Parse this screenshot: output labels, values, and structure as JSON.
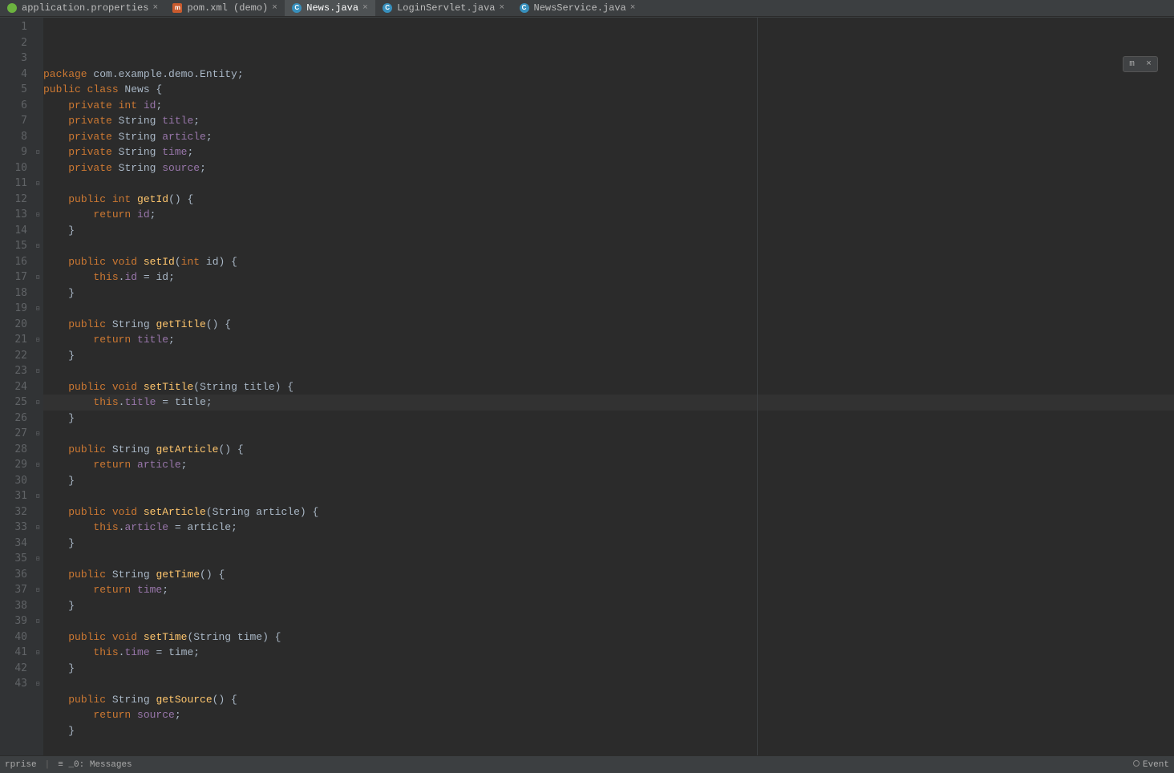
{
  "tabs": [
    {
      "icon": "spring",
      "label": "application.properties",
      "active": false
    },
    {
      "icon": "mvn",
      "label": "pom.xml (demo)",
      "active": false
    },
    {
      "icon": "java",
      "label": "News.java",
      "active": true
    },
    {
      "icon": "java",
      "label": "LoginServlet.java",
      "active": false
    },
    {
      "icon": "java",
      "label": "NewsService.java",
      "active": false
    }
  ],
  "overlay": {
    "badge": "m",
    "close": "×"
  },
  "code": [
    {
      "n": 1,
      "f": "",
      "h": [
        [
          "k",
          "package "
        ],
        [
          "t",
          "com.example.demo.Entity;"
        ]
      ]
    },
    {
      "n": 2,
      "f": "",
      "h": [
        [
          "k",
          "public class "
        ],
        [
          "t",
          "News {"
        ]
      ]
    },
    {
      "n": 3,
      "f": "",
      "h": [
        [
          "t",
          "    "
        ],
        [
          "k",
          "private int "
        ],
        [
          "v",
          "id"
        ],
        [
          "t",
          ";"
        ]
      ]
    },
    {
      "n": 4,
      "f": "",
      "h": [
        [
          "t",
          "    "
        ],
        [
          "k",
          "private "
        ],
        [
          "t",
          "String "
        ],
        [
          "v",
          "title"
        ],
        [
          "t",
          ";"
        ]
      ]
    },
    {
      "n": 5,
      "f": "",
      "h": [
        [
          "t",
          "    "
        ],
        [
          "k",
          "private "
        ],
        [
          "t",
          "String "
        ],
        [
          "v",
          "article"
        ],
        [
          "t",
          ";"
        ]
      ]
    },
    {
      "n": 6,
      "f": "",
      "h": [
        [
          "t",
          "    "
        ],
        [
          "k",
          "private "
        ],
        [
          "t",
          "String "
        ],
        [
          "v",
          "time"
        ],
        [
          "t",
          ";"
        ]
      ]
    },
    {
      "n": 7,
      "f": "",
      "h": [
        [
          "t",
          "    "
        ],
        [
          "k",
          "private "
        ],
        [
          "t",
          "String "
        ],
        [
          "v",
          "source"
        ],
        [
          "t",
          ";"
        ]
      ]
    },
    {
      "n": 8,
      "f": "",
      "h": []
    },
    {
      "n": 9,
      "f": "⊟",
      "h": [
        [
          "t",
          "    "
        ],
        [
          "k",
          "public int "
        ],
        [
          "id",
          "getId"
        ],
        [
          "t",
          "() {"
        ]
      ]
    },
    {
      "n": 10,
      "f": "",
      "h": [
        [
          "t",
          "        "
        ],
        [
          "k",
          "return "
        ],
        [
          "v",
          "id"
        ],
        [
          "t",
          ";"
        ]
      ]
    },
    {
      "n": 11,
      "f": "⊟",
      "h": [
        [
          "t",
          "    }"
        ]
      ]
    },
    {
      "n": 12,
      "f": "",
      "h": []
    },
    {
      "n": 13,
      "f": "⊟",
      "h": [
        [
          "t",
          "    "
        ],
        [
          "k",
          "public void "
        ],
        [
          "id",
          "setId"
        ],
        [
          "t",
          "("
        ],
        [
          "k",
          "int "
        ],
        [
          "t",
          "id) {"
        ]
      ]
    },
    {
      "n": 14,
      "f": "",
      "h": [
        [
          "t",
          "        "
        ],
        [
          "k",
          "this"
        ],
        [
          "t",
          "."
        ],
        [
          "v",
          "id"
        ],
        [
          "t",
          " = id;"
        ]
      ]
    },
    {
      "n": 15,
      "f": "⊟",
      "h": [
        [
          "t",
          "    }"
        ]
      ]
    },
    {
      "n": 16,
      "f": "",
      "h": []
    },
    {
      "n": 17,
      "f": "⊟",
      "h": [
        [
          "t",
          "    "
        ],
        [
          "k",
          "public "
        ],
        [
          "t",
          "String "
        ],
        [
          "id",
          "getTitle"
        ],
        [
          "t",
          "() {"
        ]
      ]
    },
    {
      "n": 18,
      "f": "",
      "h": [
        [
          "t",
          "        "
        ],
        [
          "k",
          "return "
        ],
        [
          "v",
          "title"
        ],
        [
          "t",
          ";"
        ]
      ]
    },
    {
      "n": 19,
      "f": "⊟",
      "h": [
        [
          "t",
          "    }"
        ]
      ]
    },
    {
      "n": 20,
      "f": "",
      "h": []
    },
    {
      "n": 21,
      "f": "⊟",
      "h": [
        [
          "t",
          "    "
        ],
        [
          "k",
          "public void "
        ],
        [
          "id",
          "setTitle"
        ],
        [
          "t",
          "(String title) {"
        ]
      ]
    },
    {
      "n": 22,
      "f": "",
      "hl": true,
      "h": [
        [
          "t",
          "        "
        ],
        [
          "k",
          "this"
        ],
        [
          "t",
          "."
        ],
        [
          "v",
          "title"
        ],
        [
          "t",
          " = title;"
        ]
      ]
    },
    {
      "n": 23,
      "f": "⊟",
      "h": [
        [
          "t",
          "    }"
        ]
      ]
    },
    {
      "n": 24,
      "f": "",
      "h": []
    },
    {
      "n": 25,
      "f": "⊟",
      "h": [
        [
          "t",
          "    "
        ],
        [
          "k",
          "public "
        ],
        [
          "t",
          "String "
        ],
        [
          "id",
          "getArticle"
        ],
        [
          "t",
          "() {"
        ]
      ]
    },
    {
      "n": 26,
      "f": "",
      "h": [
        [
          "t",
          "        "
        ],
        [
          "k",
          "return "
        ],
        [
          "v",
          "article"
        ],
        [
          "t",
          ";"
        ]
      ]
    },
    {
      "n": 27,
      "f": "⊟",
      "h": [
        [
          "t",
          "    }"
        ]
      ]
    },
    {
      "n": 28,
      "f": "",
      "h": []
    },
    {
      "n": 29,
      "f": "⊟",
      "h": [
        [
          "t",
          "    "
        ],
        [
          "k",
          "public void "
        ],
        [
          "id",
          "setArticle"
        ],
        [
          "t",
          "(String article) {"
        ]
      ]
    },
    {
      "n": 30,
      "f": "",
      "h": [
        [
          "t",
          "        "
        ],
        [
          "k",
          "this"
        ],
        [
          "t",
          "."
        ],
        [
          "v",
          "article"
        ],
        [
          "t",
          " = article;"
        ]
      ]
    },
    {
      "n": 31,
      "f": "⊟",
      "h": [
        [
          "t",
          "    }"
        ]
      ]
    },
    {
      "n": 32,
      "f": "",
      "h": []
    },
    {
      "n": 33,
      "f": "⊟",
      "h": [
        [
          "t",
          "    "
        ],
        [
          "k",
          "public "
        ],
        [
          "t",
          "String "
        ],
        [
          "id",
          "getTime"
        ],
        [
          "t",
          "() {"
        ]
      ]
    },
    {
      "n": 34,
      "f": "",
      "h": [
        [
          "t",
          "        "
        ],
        [
          "k",
          "return "
        ],
        [
          "v",
          "time"
        ],
        [
          "t",
          ";"
        ]
      ]
    },
    {
      "n": 35,
      "f": "⊟",
      "h": [
        [
          "t",
          "    }"
        ]
      ]
    },
    {
      "n": 36,
      "f": "",
      "h": []
    },
    {
      "n": 37,
      "f": "⊟",
      "h": [
        [
          "t",
          "    "
        ],
        [
          "k",
          "public void "
        ],
        [
          "id",
          "setTime"
        ],
        [
          "t",
          "(String time) {"
        ]
      ]
    },
    {
      "n": 38,
      "f": "",
      "h": [
        [
          "t",
          "        "
        ],
        [
          "k",
          "this"
        ],
        [
          "t",
          "."
        ],
        [
          "v",
          "time"
        ],
        [
          "t",
          " = time;"
        ]
      ]
    },
    {
      "n": 39,
      "f": "⊟",
      "h": [
        [
          "t",
          "    }"
        ]
      ]
    },
    {
      "n": 40,
      "f": "",
      "h": []
    },
    {
      "n": 41,
      "f": "⊟",
      "h": [
        [
          "t",
          "    "
        ],
        [
          "k",
          "public "
        ],
        [
          "t",
          "String "
        ],
        [
          "id",
          "getSource"
        ],
        [
          "t",
          "() {"
        ]
      ]
    },
    {
      "n": 42,
      "f": "",
      "h": [
        [
          "t",
          "        "
        ],
        [
          "k",
          "return "
        ],
        [
          "v",
          "source"
        ],
        [
          "t",
          ";"
        ]
      ]
    },
    {
      "n": 43,
      "f": "⊟",
      "h": [
        [
          "t",
          "    }"
        ]
      ]
    }
  ],
  "status": {
    "leftItem": "rprise",
    "messages": "0: Messages",
    "eventlog": "Event"
  },
  "glyphs": {
    "mvn": "m",
    "java": "C",
    "close": "×",
    "msgicon": "≡",
    "underline": "_"
  }
}
